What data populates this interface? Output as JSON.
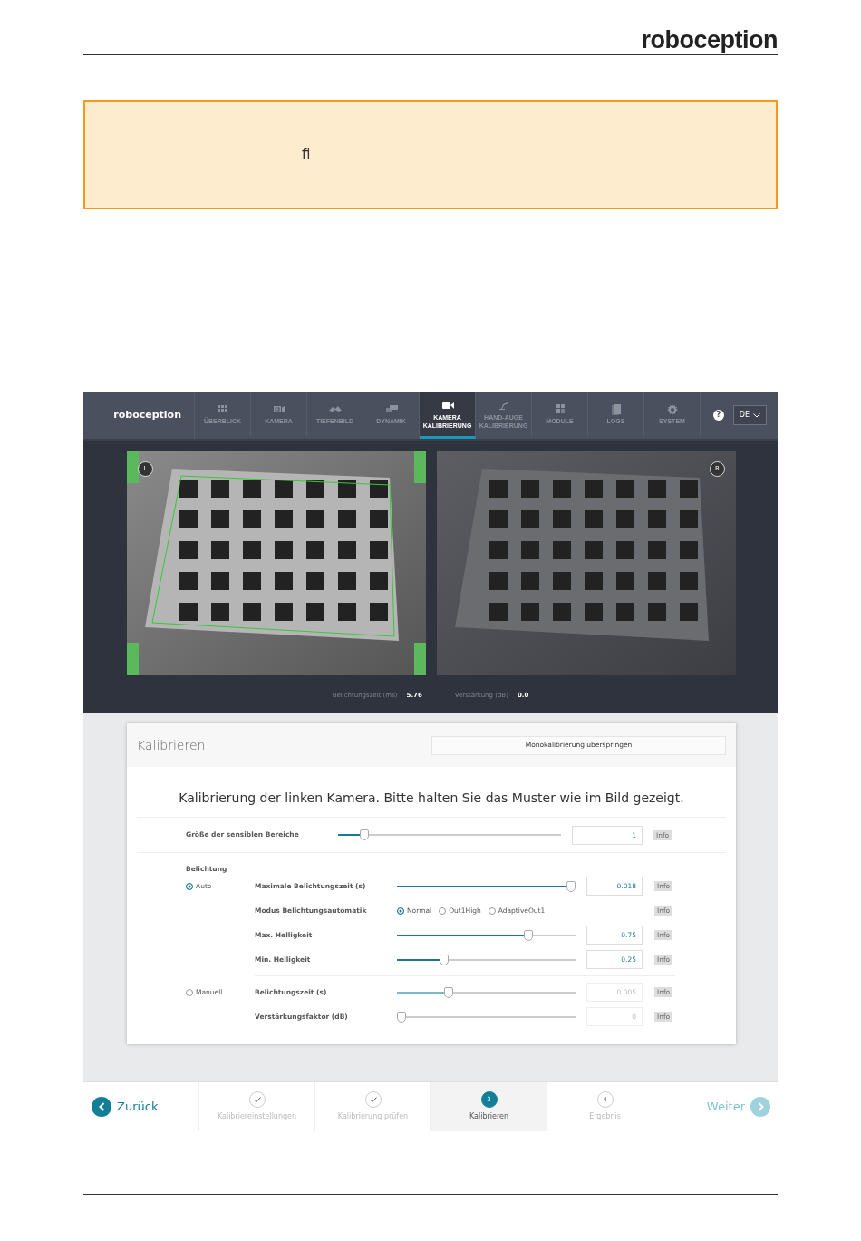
{
  "header": {
    "logo": "roboception"
  },
  "notice": {
    "text": "fi"
  },
  "app": {
    "navbar": {
      "logo": "roboception",
      "tabs": [
        {
          "label": "ÜBERBLICK",
          "selected": false
        },
        {
          "label": "KAMERA",
          "selected": false
        },
        {
          "label": "TIEFENBILD",
          "selected": false
        },
        {
          "label": "DYNAMIK",
          "selected": false
        },
        {
          "label": "KAMERA KALIBRIERUNG",
          "selected": true
        },
        {
          "label": "HAND-AUGE KALIBRIERUNG",
          "selected": false
        },
        {
          "label": "MODULE",
          "selected": false
        },
        {
          "label": "LOGS",
          "selected": false
        },
        {
          "label": "SYSTEM",
          "selected": false
        }
      ],
      "help": "?",
      "language": "DE"
    },
    "cameras": [
      {
        "badge": "L"
      },
      {
        "badge": "R"
      }
    ],
    "readings": [
      {
        "label": "Belichtungszeit (ms)",
        "value": "5.76"
      },
      {
        "label": "Verstärkung (dB)",
        "value": "0.0"
      }
    ],
    "panel": {
      "title": "Kalibrieren",
      "skip_button": "Monokalibrierung überspringen",
      "instruction": "Kalibrierung der linken Kamera. Bitte halten Sie das Muster wie im Bild gezeigt.",
      "sensitive_area": {
        "label": "Größe der sensiblen Bereiche",
        "level": 0.1,
        "value": "1",
        "info": "Info"
      },
      "exposure": {
        "heading": "Belichtung",
        "modes": [
          {
            "label": "Auto",
            "selected": true,
            "params": [
              {
                "kind": "slider",
                "label": "Maximale Belichtungszeit (s)",
                "level": 1.0,
                "value": "0.018",
                "info": "Info"
              },
              {
                "kind": "radio",
                "label": "Modus Belichtungsautomatik",
                "options": [
                  {
                    "label": "Normal",
                    "selected": true
                  },
                  {
                    "label": "Out1High",
                    "selected": false
                  },
                  {
                    "label": "AdaptiveOut1",
                    "selected": false
                  }
                ],
                "info": "Info"
              },
              {
                "kind": "slider",
                "label": "Max. Helligkeit",
                "level": 0.75,
                "value": "0.75",
                "info": "Info"
              },
              {
                "kind": "slider",
                "label": "Min. Helligkeit",
                "level": 0.25,
                "value": "0.25",
                "info": "Info"
              }
            ]
          },
          {
            "label": "Manuell",
            "selected": false,
            "params": [
              {
                "kind": "slider",
                "label": "Belichtungszeit (s)",
                "level": 0.28,
                "value": "0.005",
                "info": "Info"
              },
              {
                "kind": "slider",
                "label": "Verstärkungsfaktor (dB)",
                "level": 0.0,
                "value": "0",
                "info": "Info"
              }
            ]
          }
        ]
      }
    },
    "wizard": {
      "back": "Zurück",
      "next": "Weiter",
      "steps": [
        {
          "label": "Kalibriereinstellungen",
          "done": true,
          "selected": false
        },
        {
          "label": "Kalibrierung prüfen",
          "done": true,
          "selected": false
        },
        {
          "label": "Kalibrieren",
          "number": "3",
          "done": false,
          "selected": true
        },
        {
          "label": "Ergebnis",
          "number": "4",
          "done": false,
          "selected": false
        }
      ]
    }
  }
}
